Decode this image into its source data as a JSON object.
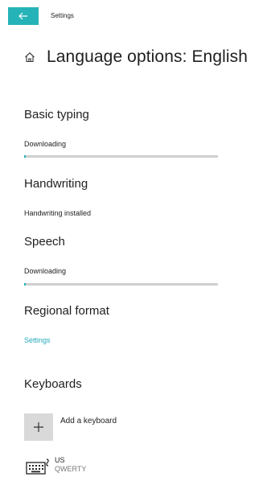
{
  "window": {
    "app_title": "Settings",
    "accent_color": "#26b3b8"
  },
  "header": {
    "title": "Language options: English",
    "icon": "home-icon"
  },
  "sections": {
    "basic_typing": {
      "title": "Basic typing",
      "status": "Downloading",
      "progress": 0.01
    },
    "handwriting": {
      "title": "Handwriting",
      "status": "Handwriting installed"
    },
    "speech": {
      "title": "Speech",
      "status": "Downloading",
      "progress": 0.01
    },
    "regional_format": {
      "title": "Regional format",
      "link": "Settings"
    },
    "keyboards": {
      "title": "Keyboards",
      "add_label": "Add a keyboard",
      "items": [
        {
          "name": "US",
          "layout": "QWERTY",
          "icon": "keyboard-icon"
        }
      ]
    }
  }
}
